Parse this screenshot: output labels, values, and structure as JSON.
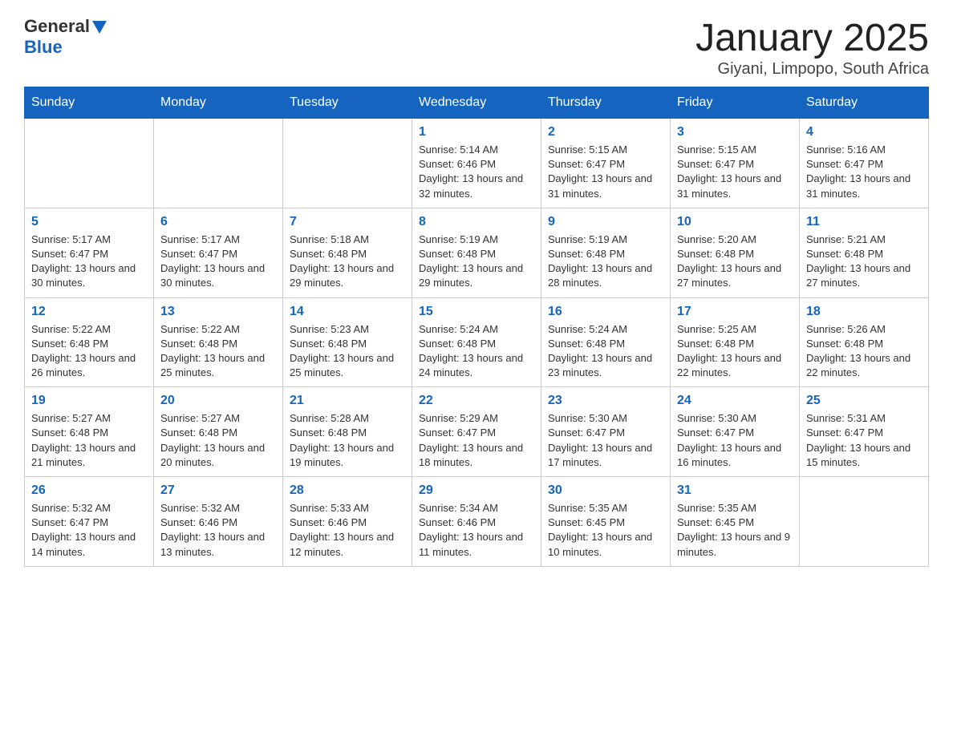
{
  "header": {
    "logo_general": "General",
    "logo_blue": "Blue",
    "month_title": "January 2025",
    "location": "Giyani, Limpopo, South Africa"
  },
  "weekdays": [
    "Sunday",
    "Monday",
    "Tuesday",
    "Wednesday",
    "Thursday",
    "Friday",
    "Saturday"
  ],
  "weeks": [
    [
      {
        "day": "",
        "info": ""
      },
      {
        "day": "",
        "info": ""
      },
      {
        "day": "",
        "info": ""
      },
      {
        "day": "1",
        "info": "Sunrise: 5:14 AM\nSunset: 6:46 PM\nDaylight: 13 hours and 32 minutes."
      },
      {
        "day": "2",
        "info": "Sunrise: 5:15 AM\nSunset: 6:47 PM\nDaylight: 13 hours and 31 minutes."
      },
      {
        "day": "3",
        "info": "Sunrise: 5:15 AM\nSunset: 6:47 PM\nDaylight: 13 hours and 31 minutes."
      },
      {
        "day": "4",
        "info": "Sunrise: 5:16 AM\nSunset: 6:47 PM\nDaylight: 13 hours and 31 minutes."
      }
    ],
    [
      {
        "day": "5",
        "info": "Sunrise: 5:17 AM\nSunset: 6:47 PM\nDaylight: 13 hours and 30 minutes."
      },
      {
        "day": "6",
        "info": "Sunrise: 5:17 AM\nSunset: 6:47 PM\nDaylight: 13 hours and 30 minutes."
      },
      {
        "day": "7",
        "info": "Sunrise: 5:18 AM\nSunset: 6:48 PM\nDaylight: 13 hours and 29 minutes."
      },
      {
        "day": "8",
        "info": "Sunrise: 5:19 AM\nSunset: 6:48 PM\nDaylight: 13 hours and 29 minutes."
      },
      {
        "day": "9",
        "info": "Sunrise: 5:19 AM\nSunset: 6:48 PM\nDaylight: 13 hours and 28 minutes."
      },
      {
        "day": "10",
        "info": "Sunrise: 5:20 AM\nSunset: 6:48 PM\nDaylight: 13 hours and 27 minutes."
      },
      {
        "day": "11",
        "info": "Sunrise: 5:21 AM\nSunset: 6:48 PM\nDaylight: 13 hours and 27 minutes."
      }
    ],
    [
      {
        "day": "12",
        "info": "Sunrise: 5:22 AM\nSunset: 6:48 PM\nDaylight: 13 hours and 26 minutes."
      },
      {
        "day": "13",
        "info": "Sunrise: 5:22 AM\nSunset: 6:48 PM\nDaylight: 13 hours and 25 minutes."
      },
      {
        "day": "14",
        "info": "Sunrise: 5:23 AM\nSunset: 6:48 PM\nDaylight: 13 hours and 25 minutes."
      },
      {
        "day": "15",
        "info": "Sunrise: 5:24 AM\nSunset: 6:48 PM\nDaylight: 13 hours and 24 minutes."
      },
      {
        "day": "16",
        "info": "Sunrise: 5:24 AM\nSunset: 6:48 PM\nDaylight: 13 hours and 23 minutes."
      },
      {
        "day": "17",
        "info": "Sunrise: 5:25 AM\nSunset: 6:48 PM\nDaylight: 13 hours and 22 minutes."
      },
      {
        "day": "18",
        "info": "Sunrise: 5:26 AM\nSunset: 6:48 PM\nDaylight: 13 hours and 22 minutes."
      }
    ],
    [
      {
        "day": "19",
        "info": "Sunrise: 5:27 AM\nSunset: 6:48 PM\nDaylight: 13 hours and 21 minutes."
      },
      {
        "day": "20",
        "info": "Sunrise: 5:27 AM\nSunset: 6:48 PM\nDaylight: 13 hours and 20 minutes."
      },
      {
        "day": "21",
        "info": "Sunrise: 5:28 AM\nSunset: 6:48 PM\nDaylight: 13 hours and 19 minutes."
      },
      {
        "day": "22",
        "info": "Sunrise: 5:29 AM\nSunset: 6:47 PM\nDaylight: 13 hours and 18 minutes."
      },
      {
        "day": "23",
        "info": "Sunrise: 5:30 AM\nSunset: 6:47 PM\nDaylight: 13 hours and 17 minutes."
      },
      {
        "day": "24",
        "info": "Sunrise: 5:30 AM\nSunset: 6:47 PM\nDaylight: 13 hours and 16 minutes."
      },
      {
        "day": "25",
        "info": "Sunrise: 5:31 AM\nSunset: 6:47 PM\nDaylight: 13 hours and 15 minutes."
      }
    ],
    [
      {
        "day": "26",
        "info": "Sunrise: 5:32 AM\nSunset: 6:47 PM\nDaylight: 13 hours and 14 minutes."
      },
      {
        "day": "27",
        "info": "Sunrise: 5:32 AM\nSunset: 6:46 PM\nDaylight: 13 hours and 13 minutes."
      },
      {
        "day": "28",
        "info": "Sunrise: 5:33 AM\nSunset: 6:46 PM\nDaylight: 13 hours and 12 minutes."
      },
      {
        "day": "29",
        "info": "Sunrise: 5:34 AM\nSunset: 6:46 PM\nDaylight: 13 hours and 11 minutes."
      },
      {
        "day": "30",
        "info": "Sunrise: 5:35 AM\nSunset: 6:45 PM\nDaylight: 13 hours and 10 minutes."
      },
      {
        "day": "31",
        "info": "Sunrise: 5:35 AM\nSunset: 6:45 PM\nDaylight: 13 hours and 9 minutes."
      },
      {
        "day": "",
        "info": ""
      }
    ]
  ]
}
